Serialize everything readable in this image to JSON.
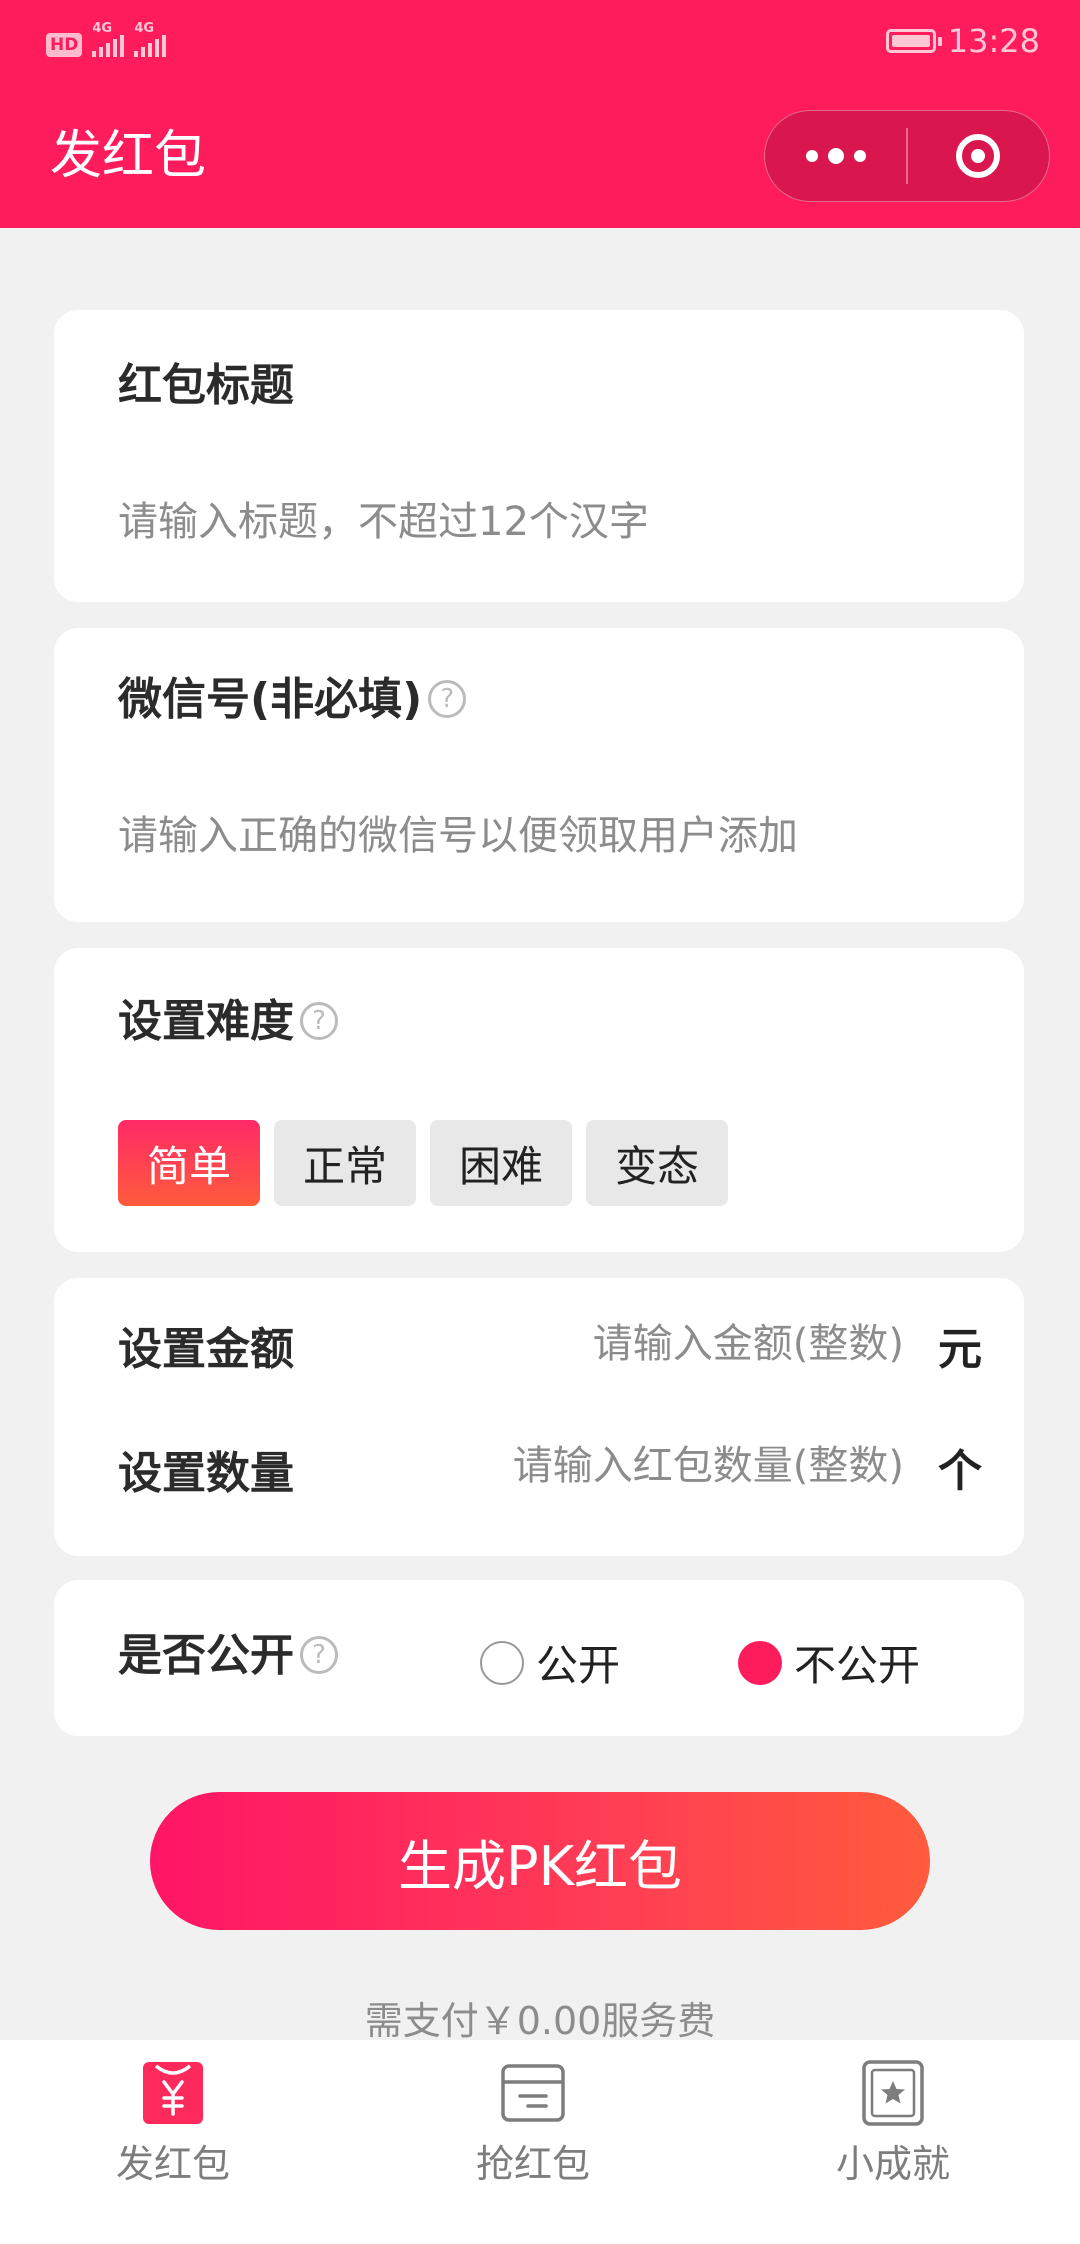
{
  "status_bar": {
    "hd": "HD",
    "signal1": "4G",
    "signal2": "4G",
    "time": "13:28"
  },
  "header": {
    "title": "发红包"
  },
  "title_card": {
    "label": "红包标题",
    "placeholder": "请输入标题，不超过12个汉字"
  },
  "wechat_card": {
    "label": "微信号(非必填)",
    "placeholder": "请输入正确的微信号以便领取用户添加"
  },
  "difficulty_card": {
    "label": "设置难度",
    "options": [
      "简单",
      "正常",
      "困难",
      "变态"
    ],
    "selected": "简单"
  },
  "amount_card": {
    "amount_label": "设置金额",
    "amount_placeholder": "请输入金额(整数)",
    "amount_unit": "元",
    "count_label": "设置数量",
    "count_placeholder": "请输入红包数量(整数)",
    "count_unit": "个"
  },
  "public_card": {
    "label": "是否公开",
    "option_public": "公开",
    "option_private": "不公开",
    "selected": "不公开"
  },
  "cta": {
    "label": "生成PK红包"
  },
  "fee_text": "需支付￥0.00服务费",
  "tabbar": {
    "items": [
      {
        "label": "发红包",
        "icon": "red-envelope-yen-icon",
        "active": true
      },
      {
        "label": "抢红包",
        "icon": "wallet-icon",
        "active": false
      },
      {
        "label": "小成就",
        "icon": "star-badge-icon",
        "active": false
      }
    ]
  },
  "colors": {
    "primary": "#ff1c5c",
    "gradient_end": "#ff5b3c",
    "background": "#f1f1f1"
  }
}
